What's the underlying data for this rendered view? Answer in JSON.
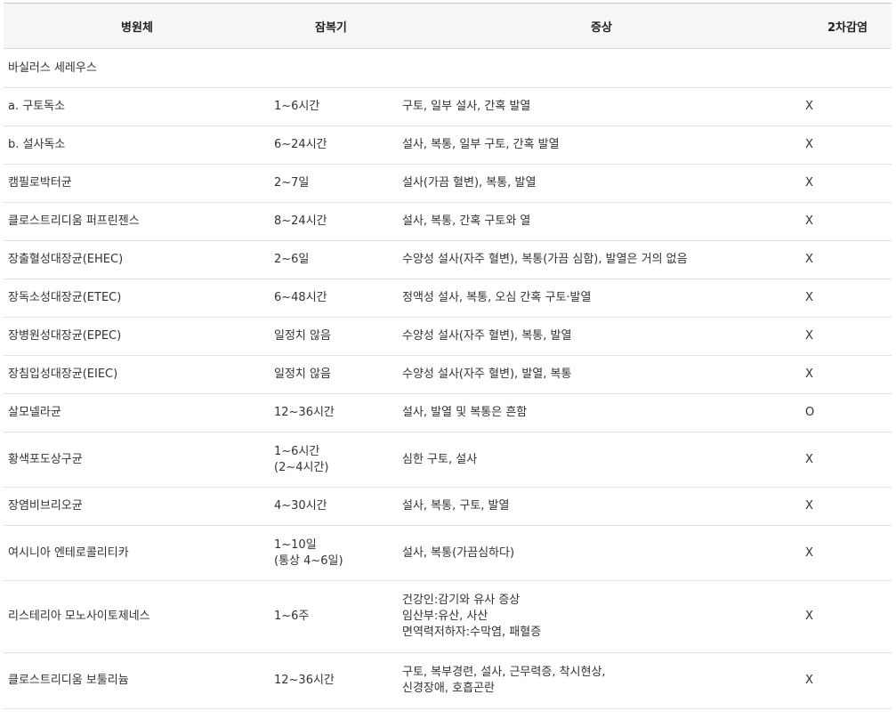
{
  "table": {
    "headers": {
      "pathogen": "병원체",
      "incubation": "잠복기",
      "symptoms": "증상",
      "secondary": "2차감염"
    },
    "group_row": "바실러스 세레우스",
    "rows": [
      {
        "pathogen": "a. 구토독소",
        "incubation": [
          "1~6시간"
        ],
        "symptoms": [
          "구토, 일부 설사, 간혹 발열"
        ],
        "secondary": "X"
      },
      {
        "pathogen": "b. 설사독소",
        "incubation": [
          "6~24시간"
        ],
        "symptoms": [
          "설사, 복통, 일부 구토, 간혹 발열"
        ],
        "secondary": "X"
      },
      {
        "pathogen": "캠필로박터균",
        "incubation": [
          "2~7일"
        ],
        "symptoms": [
          "설사(가끔 혈변), 복통, 발열"
        ],
        "secondary": "X"
      },
      {
        "pathogen": "클로스트리디움 퍼프린젠스",
        "incubation": [
          "8~24시간"
        ],
        "symptoms": [
          "설사, 복통, 간혹 구토와 열"
        ],
        "secondary": "X"
      },
      {
        "pathogen": "장출혈성대장균(EHEC)",
        "incubation": [
          "2~6일"
        ],
        "symptoms": [
          "수양성 설사(자주 혈변), 복통(가끔 심함), 발열은 거의 없음"
        ],
        "secondary": "X"
      },
      {
        "pathogen": "장독소성대장균(ETEC)",
        "incubation": [
          "6~48시간"
        ],
        "symptoms": [
          "정액성 설사, 복통, 오심 간혹 구토·발열"
        ],
        "secondary": "X"
      },
      {
        "pathogen": "장병원성대장균(EPEC)",
        "incubation": [
          "일정치 않음"
        ],
        "symptoms": [
          "수양성 설사(자주 혈변), 복통, 발열"
        ],
        "secondary": "X"
      },
      {
        "pathogen": "장침입성대장균(EIEC)",
        "incubation": [
          "일정치 않음"
        ],
        "symptoms": [
          "수양성 설사(자주 혈변), 발열, 복통"
        ],
        "secondary": "X"
      },
      {
        "pathogen": "살모넬라균",
        "incubation": [
          "12~36시간"
        ],
        "symptoms": [
          "설사, 발열 및 복통은 흔함"
        ],
        "secondary": "O"
      },
      {
        "pathogen": "황색포도상구균",
        "incubation": [
          "1~6시간",
          "(2~4시간)"
        ],
        "symptoms": [
          "심한 구토, 설사"
        ],
        "secondary": "X"
      },
      {
        "pathogen": "장염비브리오균",
        "incubation": [
          "4~30시간"
        ],
        "symptoms": [
          "설사, 복통, 구토, 발열"
        ],
        "secondary": "X"
      },
      {
        "pathogen": "여시니아 엔테로콜리티카",
        "incubation": [
          "1~10일",
          "(통상 4~6일)"
        ],
        "symptoms": [
          "설사, 복통(가끔심하다)"
        ],
        "secondary": "X"
      },
      {
        "pathogen": "리스테리아 모노사이토제네스",
        "incubation": [
          "1~6주"
        ],
        "symptoms": [
          "건강인:감기와 유사 증상",
          "임산부:유산, 사산",
          "면역력저하자:수막염, 패혈증"
        ],
        "secondary": "X"
      },
      {
        "pathogen": "클로스트리디움 보툴리늄",
        "incubation": [
          "12~36시간"
        ],
        "symptoms": [
          "구토, 복부경련, 설사, 근무력증, 착시현상,",
          "신경장애, 호흡곤란"
        ],
        "secondary": "X"
      }
    ]
  }
}
